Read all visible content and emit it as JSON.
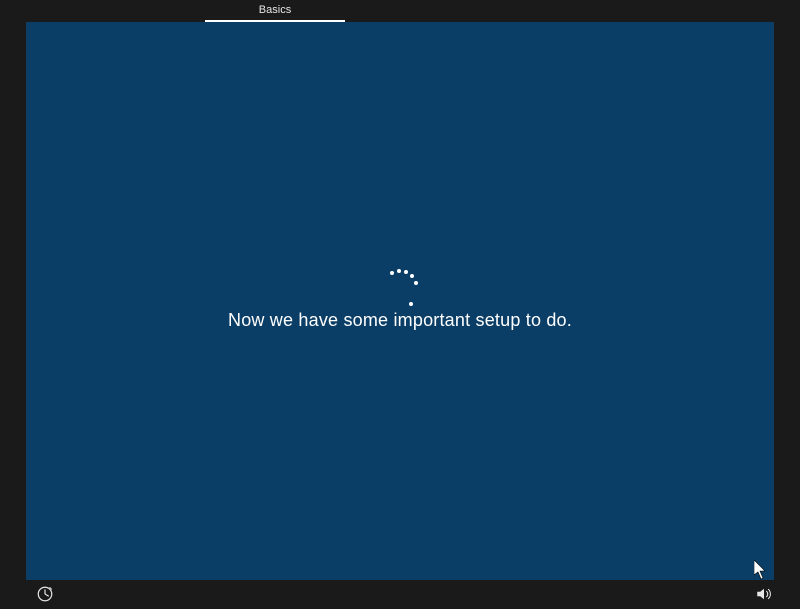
{
  "tabs": {
    "active_label": "Basics"
  },
  "message": "Now we have some important setup to do.",
  "icons": {
    "ease_of_access": "ease-of-access-icon",
    "volume": "volume-icon",
    "cursor": "cursor-arrow"
  },
  "colors": {
    "frame_bg": "#1a1a1a",
    "stage_bg": "#0b3e66",
    "text": "#ffffff"
  }
}
